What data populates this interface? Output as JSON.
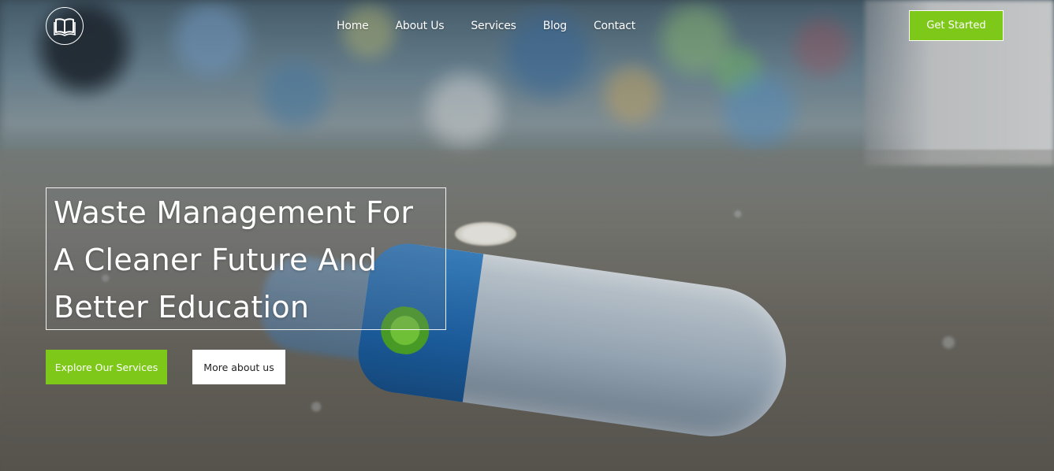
{
  "header": {
    "logo_icon": "open-book-icon",
    "nav": [
      {
        "label": "Home"
      },
      {
        "label": "About Us"
      },
      {
        "label": "Services"
      },
      {
        "label": "Blog"
      },
      {
        "label": "Contact"
      }
    ],
    "cta_label": "Get Started"
  },
  "hero": {
    "background_image": "plastic-bottle-on-wet-ground-with-waste-pile",
    "headline_lines": [
      "Waste Management For",
      "A Cleaner Future And",
      "Better Education"
    ],
    "primary_button": "Explore Our Services",
    "secondary_button": "More about us"
  },
  "colors": {
    "accent_green": "#7ec819",
    "text_white": "#ffffff",
    "button_white": "#ffffff"
  }
}
